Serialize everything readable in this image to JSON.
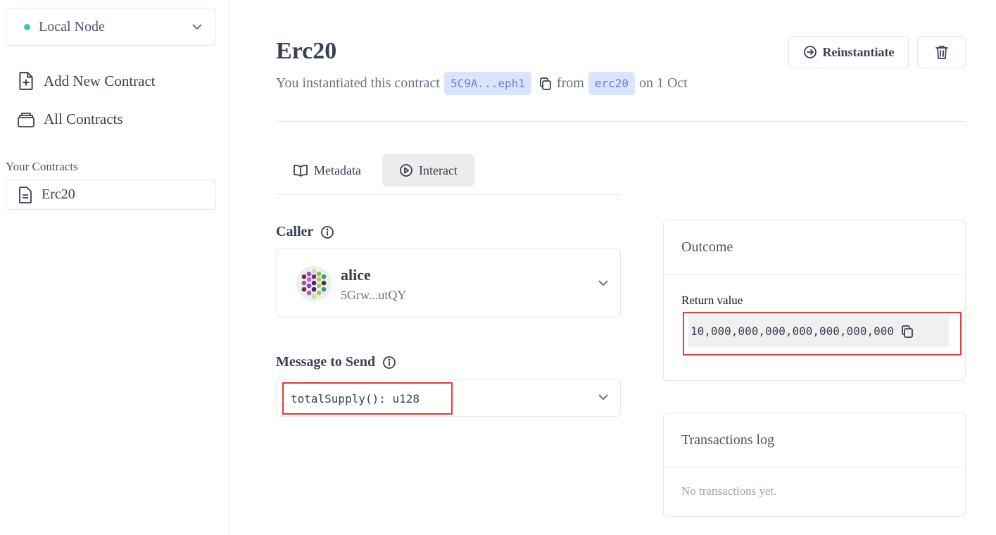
{
  "sidebar": {
    "node": {
      "label": "Local Node",
      "status_color": "#34d399"
    },
    "nav": [
      {
        "label": "Add New Contract",
        "icon": "document-plus-icon"
      },
      {
        "label": "All Contracts",
        "icon": "collection-icon"
      }
    ],
    "your_contracts_title": "Your Contracts",
    "contracts": [
      {
        "label": "Erc20",
        "icon": "document-text-icon"
      }
    ]
  },
  "header": {
    "title": "Erc20",
    "subtitle_prefix": "You instantiated this contract",
    "address_short": "5C9A...eph1",
    "from_text": "from",
    "code_name": "erc20",
    "date_text": "on 1 Oct",
    "reinstantiate_label": "Reinstantiate"
  },
  "tabs": [
    {
      "label": "Metadata",
      "icon": "book-open-icon",
      "active": false
    },
    {
      "label": "Interact",
      "icon": "play-circle-icon",
      "active": true
    }
  ],
  "caller": {
    "label": "Caller",
    "name": "alice",
    "address": "5Grw...utQY"
  },
  "message": {
    "label": "Message to Send",
    "value": "totalSupply(): u128"
  },
  "outcome": {
    "title": "Outcome",
    "return_label": "Return value",
    "return_value": "10,000,000,000,000,000,000,000"
  },
  "transactions": {
    "title": "Transactions log",
    "empty_text": "No transactions yet."
  },
  "colors": {
    "accent_chip_bg": "#dbe4ff",
    "accent_chip_text": "#6b7fe0",
    "highlight_outline": "#e03c3c",
    "active_tab_bg": "#ececec"
  }
}
